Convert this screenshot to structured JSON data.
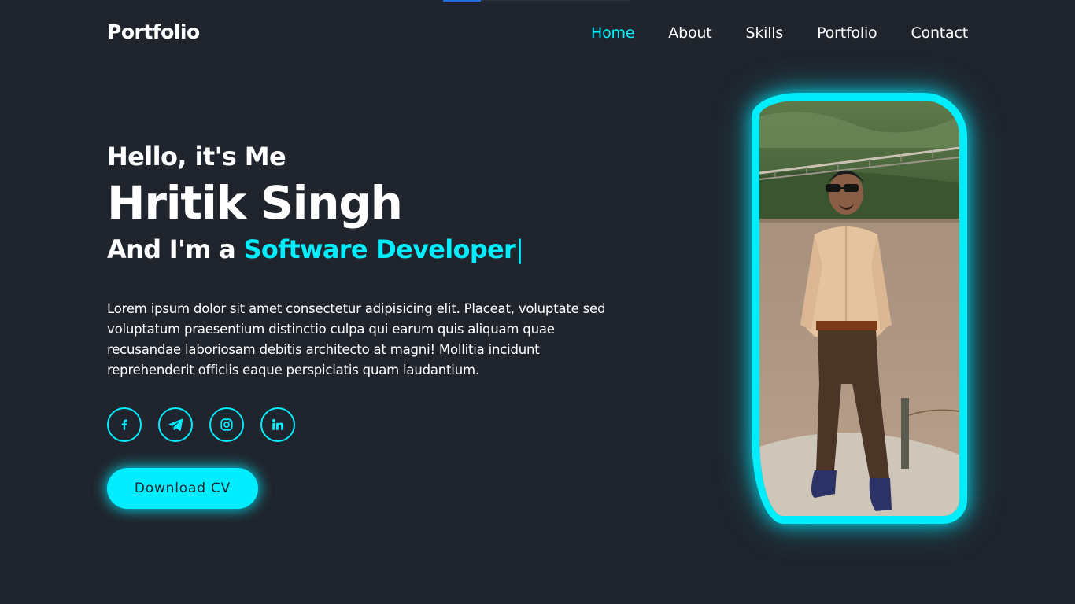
{
  "header": {
    "logo": "Portfolio",
    "nav": [
      {
        "label": "Home",
        "active": true
      },
      {
        "label": "About",
        "active": false
      },
      {
        "label": "Skills",
        "active": false
      },
      {
        "label": "Portfolio",
        "active": false
      },
      {
        "label": "Contact",
        "active": false
      }
    ]
  },
  "hero": {
    "greeting": "Hello, it's Me",
    "name": "Hritik Singh",
    "role_prefix": "And I'm a ",
    "role": "Software Developer",
    "cursor": "|",
    "description": "Lorem ipsum dolor sit amet consectetur adipisicing elit. Placeat, voluptate sed voluptatum praesentium distinctio culpa qui earum quis aliquam quae recusandae laboriosam debitis architecto at magni! Mollitia incidunt reprehenderit officiis eaque perspiciatis quam laudantium.",
    "socials": [
      {
        "icon": "facebook-icon"
      },
      {
        "icon": "telegram-icon"
      },
      {
        "icon": "instagram-icon"
      },
      {
        "icon": "linkedin-icon"
      }
    ],
    "cta": "Download CV"
  },
  "colors": {
    "background": "#1f242d",
    "accent": "#00eeff",
    "text": "#ffffff"
  }
}
